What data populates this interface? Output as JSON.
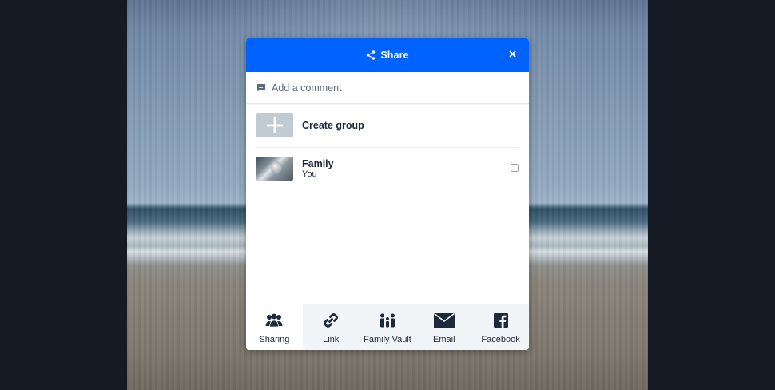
{
  "dialog": {
    "title": "Share",
    "header_color": "#0062ff",
    "comment_placeholder": "Add a comment"
  },
  "groups": {
    "create_label": "Create group",
    "items": [
      {
        "name": "Family",
        "members": "You",
        "checked": false
      }
    ]
  },
  "bottom_bar": {
    "items": [
      {
        "label": "Sharing",
        "icon": "people-icon",
        "active": true
      },
      {
        "label": "Link",
        "icon": "link-icon",
        "active": false
      },
      {
        "label": "Family Vault",
        "icon": "family-icon",
        "active": false
      },
      {
        "label": "Email",
        "icon": "envelope-icon",
        "active": false
      },
      {
        "label": "Facebook",
        "icon": "facebook-icon",
        "active": false
      }
    ]
  }
}
